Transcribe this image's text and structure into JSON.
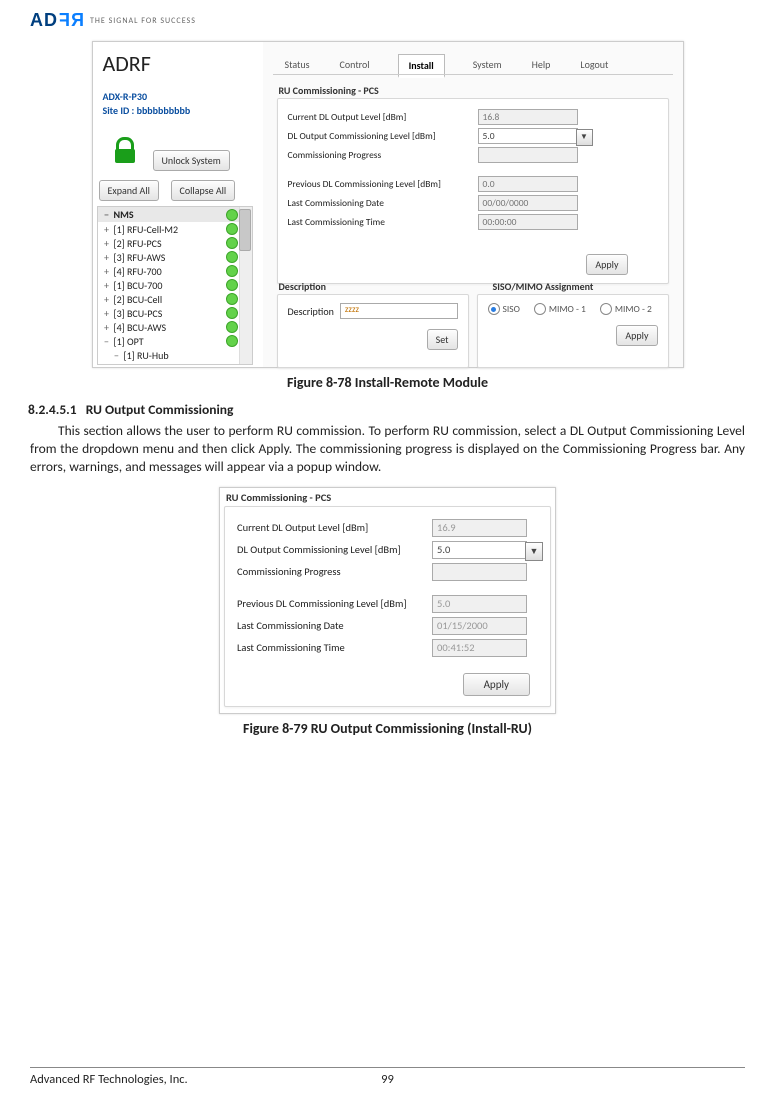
{
  "header": {
    "logo_ad": "AD",
    "logo_rf": "RF",
    "tagline": "THE SIGNAL FOR SUCCESS"
  },
  "shot1": {
    "device_model": "ADX-R-P30",
    "site_id_label": "Site ID : bbbbbbbbbb",
    "unlock_btn": "Unlock System",
    "expand_btn": "Expand All",
    "collapse_btn": "Collapse All",
    "tree_root": "NMS",
    "tree": [
      "[1] RFU-Cell-M2",
      "[2] RFU-PCS",
      "[3] RFU-AWS",
      "[4] RFU-700",
      "[1] BCU-700",
      "[2] BCU-Cell",
      "[3] BCU-PCS",
      "[4] BCU-AWS",
      "[1] OPT",
      "[1] RU-Hub"
    ],
    "tabs": {
      "status": "Status",
      "control": "Control",
      "install": "Install",
      "system": "System",
      "help": "Help",
      "logout": "Logout"
    },
    "panel1_title": "RU Commissioning - PCS",
    "rows": {
      "r1l": "Current DL Output Level [dBm]",
      "r1v": "16.8",
      "r2l": "DL Output Commissioning Level [dBm]",
      "r2v": "5.0",
      "r3l": "Commissioning Progress",
      "r4l": "Previous DL Commissioning Level [dBm]",
      "r4v": "0.0",
      "r5l": "Last Commissioning Date",
      "r5v": "00/00/0000",
      "r6l": "Last Commissioning Time",
      "r6v": "00:00:00",
      "apply": "Apply"
    },
    "desc_title": "Description",
    "desc_label": "Description",
    "desc_value": "zzzz",
    "set_btn": "Set",
    "siso_title": "SISO/MIMO Assignment",
    "siso": "SISO",
    "mimo1": "MIMO - 1",
    "mimo2": "MIMO - 2",
    "apply2": "Apply"
  },
  "caption1": "Figure 8-78    Install-Remote Module",
  "section_no": "8.2.4.5.1",
  "section_title": "RU Output Commissioning",
  "body": "This section allows the user to perform RU commission. To perform RU commission, select a DL Output Commissioning Level from the dropdown menu and then click Apply. The commissioning progress is displayed on the Commissioning Progress bar.  Any errors, warnings, and messages will appear via a popup window.",
  "shot2": {
    "title": "RU Commissioning - PCS",
    "r1l": "Current DL Output Level [dBm]",
    "r1v": "16.9",
    "r2l": "DL Output Commissioning Level [dBm]",
    "r2v": "5.0",
    "r3l": "Commissioning Progress",
    "r4l": "Previous DL Commissioning Level [dBm]",
    "r4v": "5.0",
    "r5l": "Last Commissioning Date",
    "r5v": "01/15/2000",
    "r6l": "Last Commissioning Time",
    "r6v": "00:41:52",
    "apply": "Apply"
  },
  "caption2": "Figure 8-79    RU Output Commissioning (Install-RU)",
  "footer": {
    "company": "Advanced RF Technologies, Inc.",
    "page": "99"
  },
  "chart_data": {
    "type": "table",
    "title": "RU Commissioning values shown in figures 8-78 and 8-79",
    "series": [
      {
        "name": "Figure 8-78",
        "fields": {
          "Current DL Output Level [dBm]": 16.8,
          "DL Output Commissioning Level [dBm]": 5.0,
          "Previous DL Commissioning Level [dBm]": 0.0,
          "Last Commissioning Date": "00/00/0000",
          "Last Commissioning Time": "00:00:00"
        }
      },
      {
        "name": "Figure 8-79",
        "fields": {
          "Current DL Output Level [dBm]": 16.9,
          "DL Output Commissioning Level [dBm]": 5.0,
          "Previous DL Commissioning Level [dBm]": 5.0,
          "Last Commissioning Date": "01/15/2000",
          "Last Commissioning Time": "00:41:52"
        }
      }
    ]
  }
}
